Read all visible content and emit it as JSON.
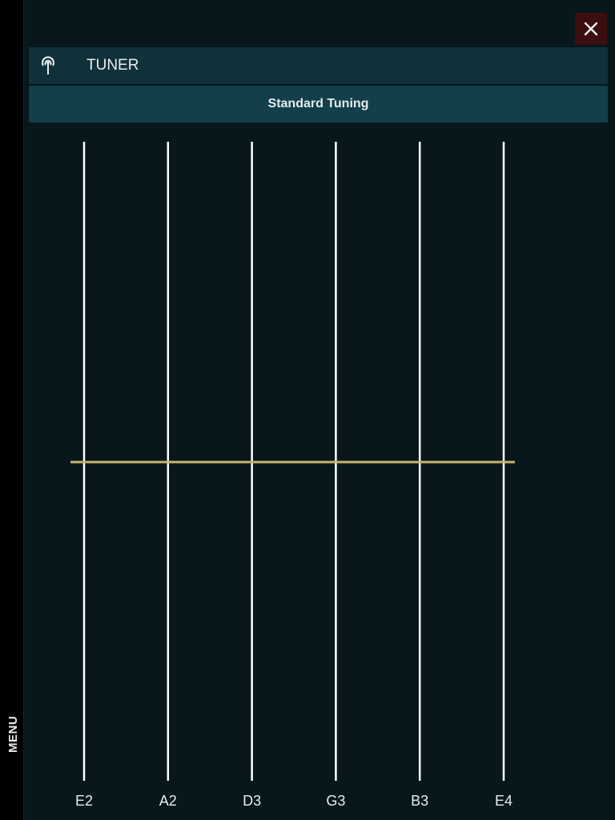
{
  "sidebar": {
    "menu_label": "MENU"
  },
  "header": {
    "title": "TUNER",
    "icon": "antenna-broadcast-icon"
  },
  "close_icon": "close-icon",
  "tuning": {
    "label": "Standard Tuning"
  },
  "tuner": {
    "strings": [
      "E2",
      "A2",
      "D3",
      "G3",
      "B3",
      "E4"
    ],
    "string_color": "#ffffff",
    "pitch_line_color": "#c8b46e"
  },
  "colors": {
    "background": "#07171c",
    "header_bar": "#10303a",
    "tuning_bar": "#133f4b",
    "close_button": "#3c0e10"
  }
}
